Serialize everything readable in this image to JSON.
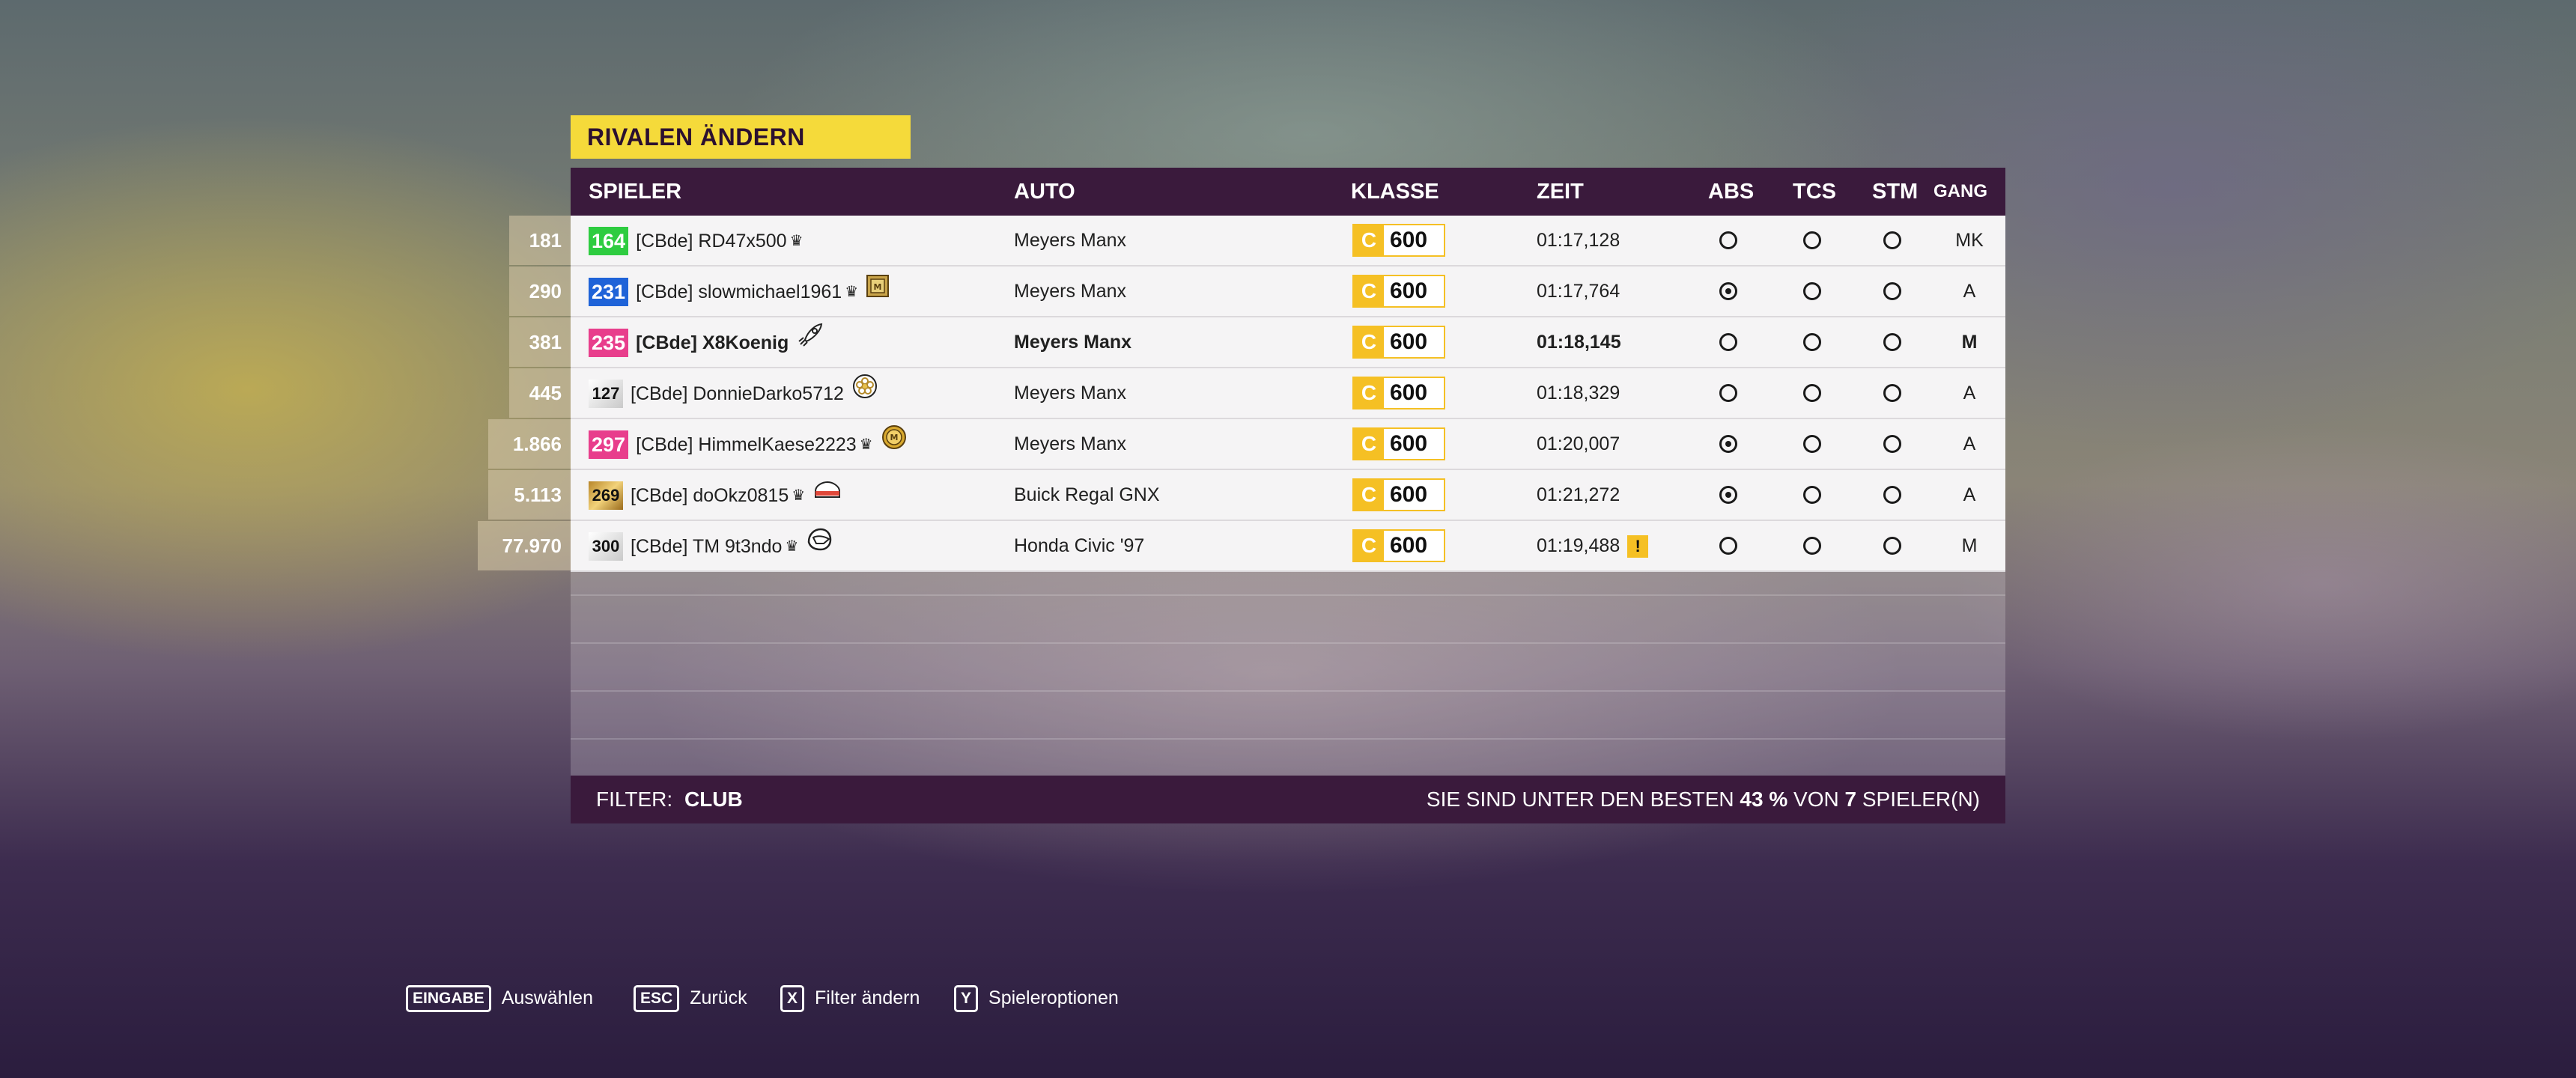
{
  "title": "RIVALEN ÄNDERN",
  "columns": {
    "player": "SPIELER",
    "car": "AUTO",
    "class": "KLASSE",
    "time": "ZEIT",
    "abs": "ABS",
    "tcs": "TCS",
    "stm": "STM",
    "gear": "GANG"
  },
  "rows": [
    {
      "rank": "181",
      "level": "164",
      "level_style": "green",
      "name": "[CBde] RD47x500",
      "crown": true,
      "badge_icon": null,
      "car": "Meyers Manx",
      "class_letter": "C",
      "pi": "600",
      "time": "01:17,128",
      "warning": false,
      "abs": false,
      "tcs": false,
      "stm": false,
      "gear": "MK",
      "highlight": false
    },
    {
      "rank": "290",
      "level": "231",
      "level_style": "blue",
      "name": "[CBde] slowmichael1961",
      "crown": true,
      "badge_icon": "medal-square-icon",
      "car": "Meyers Manx",
      "class_letter": "C",
      "pi": "600",
      "time": "01:17,764",
      "warning": false,
      "abs": true,
      "tcs": false,
      "stm": false,
      "gear": "A",
      "highlight": false
    },
    {
      "rank": "381",
      "level": "235",
      "level_style": "pink",
      "name": "[CBde] X8Koenig",
      "crown": false,
      "badge_icon": "rocket-icon",
      "car": "Meyers Manx",
      "class_letter": "C",
      "pi": "600",
      "time": "01:18,145",
      "warning": false,
      "abs": false,
      "tcs": false,
      "stm": false,
      "gear": "M",
      "highlight": true
    },
    {
      "rank": "445",
      "level": "127",
      "level_style": "silver",
      "name": "[CBde] DonnieDarko5712",
      "crown": false,
      "badge_icon": "flower-icon",
      "car": "Meyers Manx",
      "class_letter": "C",
      "pi": "600",
      "time": "01:18,329",
      "warning": false,
      "abs": false,
      "tcs": false,
      "stm": false,
      "gear": "A",
      "highlight": false
    },
    {
      "rank": "1.866",
      "level": "297",
      "level_style": "pink",
      "name": "[CBde] HimmelKaese2223",
      "crown": true,
      "badge_icon": "gold-medal-icon",
      "car": "Meyers Manx",
      "class_letter": "C",
      "pi": "600",
      "time": "01:20,007",
      "warning": false,
      "abs": true,
      "tcs": false,
      "stm": false,
      "gear": "A",
      "highlight": false
    },
    {
      "rank": "5.113",
      "level": "269",
      "level_style": "gold",
      "name": "[CBde] doOkz0815",
      "crown": true,
      "badge_icon": "cake-icon",
      "car": "Buick Regal GNX",
      "class_letter": "C",
      "pi": "600",
      "time": "01:21,272",
      "warning": false,
      "abs": true,
      "tcs": false,
      "stm": false,
      "gear": "A",
      "highlight": false
    },
    {
      "rank": "77.970",
      "level": "300",
      "level_style": "silver",
      "name": "[CBde] TM 9t3ndo",
      "crown": true,
      "badge_icon": "helmet-icon",
      "car": "Honda Civic '97",
      "class_letter": "C",
      "pi": "600",
      "time": "01:19,488",
      "warning": true,
      "abs": false,
      "tcs": false,
      "stm": false,
      "gear": "M",
      "highlight": false
    }
  ],
  "footer": {
    "filter_label": "FILTER:",
    "filter_value": "CLUB",
    "stat_prefix": "SIE SIND UNTER DEN BESTEN",
    "stat_percent": "43 %",
    "stat_mid": "VON",
    "stat_count": "7",
    "stat_suffix": "SPIELER(N)"
  },
  "hints": [
    {
      "key": "EINGABE",
      "label": "Auswählen"
    },
    {
      "key": "ESC",
      "label": "Zurück"
    },
    {
      "key": "X",
      "label": "Filter ändern"
    },
    {
      "key": "Y",
      "label": "Spieleroptionen"
    }
  ],
  "colors": {
    "accent_yellow": "#f5da3a",
    "header_purple": "#3a1a3c",
    "class_c": "#f5c024"
  }
}
